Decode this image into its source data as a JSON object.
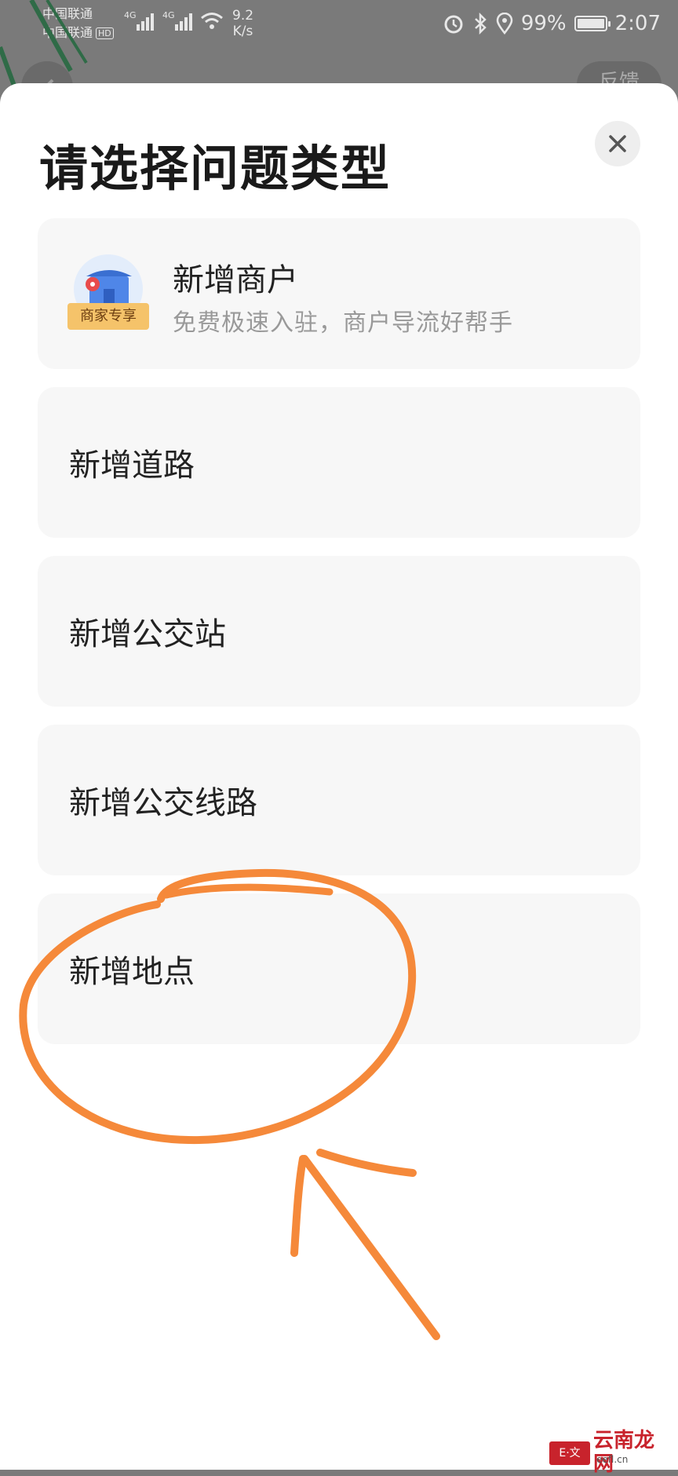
{
  "status_bar": {
    "carrier_1": "中国联通",
    "carrier_2": "中国联通",
    "carrier_2_badge": "HD",
    "network_1": "4G",
    "network_2": "4G",
    "speed_value": "9.2",
    "speed_unit": "K/s",
    "battery": "99%",
    "time": "2:07"
  },
  "background": {
    "right_button_label": "反馈"
  },
  "sheet": {
    "title": "请选择问题类型",
    "close_icon": "close-icon",
    "options": [
      {
        "title": "新增商户",
        "subtitle": "免费极速入驻，商户导流好帮手",
        "badge": "商家专享",
        "icon": "merchant-store-icon"
      },
      {
        "title": "新增道路"
      },
      {
        "title": "新增公交站"
      },
      {
        "title": "新增公交线路"
      },
      {
        "title": "新增地点"
      }
    ]
  },
  "annotation": {
    "color": "#f5893a",
    "shapes": [
      "circle-around-新增地点",
      "arrow-pointing-up"
    ]
  },
  "watermark": {
    "text": "云南龙网",
    "badge": "E·文",
    "url": "eefl.cn"
  }
}
